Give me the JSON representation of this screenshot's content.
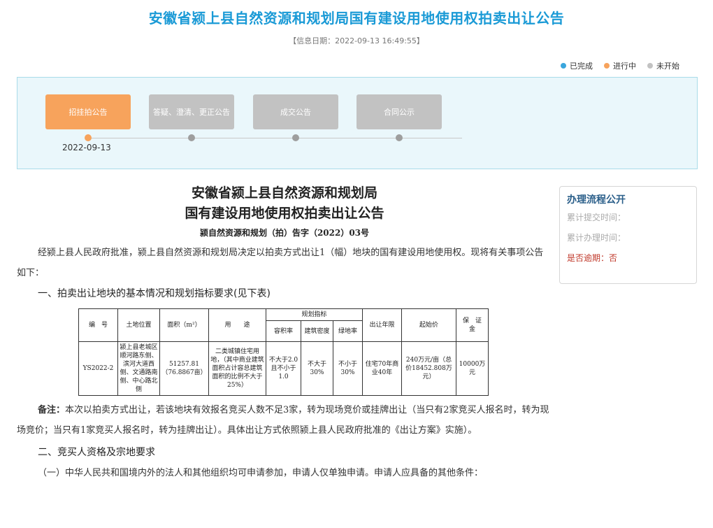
{
  "header": {
    "title": "安徽省颍上县自然资源和规划局国有建设用地使用权拍卖出让公告",
    "info_date": "【信息日期：2022-09-13 16:49:55】"
  },
  "legend": [
    {
      "label": "已完成",
      "color": "#3aa6dd"
    },
    {
      "label": "进行中",
      "color": "#f7a35c"
    },
    {
      "label": "未开始",
      "color": "#c2c2c2"
    }
  ],
  "progress": {
    "steps": [
      {
        "label": "招挂拍公告",
        "state": "active"
      },
      {
        "label": "答疑、澄清、更正公告",
        "state": "pending"
      },
      {
        "label": "成交公告",
        "state": "pending"
      },
      {
        "label": "合同公示",
        "state": "pending"
      }
    ],
    "active_date": "2022-09-13"
  },
  "notice": {
    "title_line1": "安徽省颍上县自然资源和规划局",
    "title_line2": "国有建设用地使用权拍卖出让公告",
    "doc_number": "颍自然资源和规划（拍）告字（2022）03号",
    "intro": "经颍上县人民政府批准，颍上县自然资源和规划局决定以拍卖方式出让1（幅）地块的国有建设用地使用权。现将有关事项公告如下：",
    "section1": "一、拍卖出让地块的基本情况和规划指标要求(见下表)",
    "table": {
      "headers": {
        "number": "编　号",
        "location": "土地位置",
        "area": "面积（m²）",
        "usage": "用　　途",
        "planning": "规划指标",
        "far": "容积率",
        "density": "建筑密度",
        "green": "绿地率",
        "term": "出让年限",
        "start_price": "起始价",
        "deposit": "保　证　金"
      },
      "row": {
        "number": "YS2022-2",
        "location": "颍上县老城区顺河路东侧、滨河大道西侧、文通路南侧、中心路北侧",
        "area": "51257.81（76.8867亩）",
        "usage": "二类城镇住宅用地，（其中商业建筑面积占计容总建筑面积的比例不大于25%）",
        "far": "不大于2.0且不小于1.0",
        "density": "不大于30%",
        "green": "不小于30%",
        "term": "住宅70年商业40年",
        "start_price": "240万元/亩（总价18452.808万元）",
        "deposit": "10000万元"
      }
    },
    "remark_label": "备注：",
    "remark_text": "本次以拍卖方式出让，若该地块有效报名竞买人数不足3家，转为现场竞价或挂牌出让（当只有2家竞买人报名时，转为现场竞价；当只有1家竞买人报名时，转为挂牌出让）。具体出让方式依照颍上县人民政府批准的《出让方案》实施）。",
    "section2": "二、竞买人资格及宗地要求",
    "clause1": "（一）中华人民共和国境内外的法人和其他组织均可申请参加，申请人仅单独申请。申请人应具备的其他条件："
  },
  "side_panel": {
    "title": "办理流程公开",
    "submit_time": "累计提交时间：",
    "process_time": "累计办理时间：",
    "overdue": "是否逾期：否"
  }
}
